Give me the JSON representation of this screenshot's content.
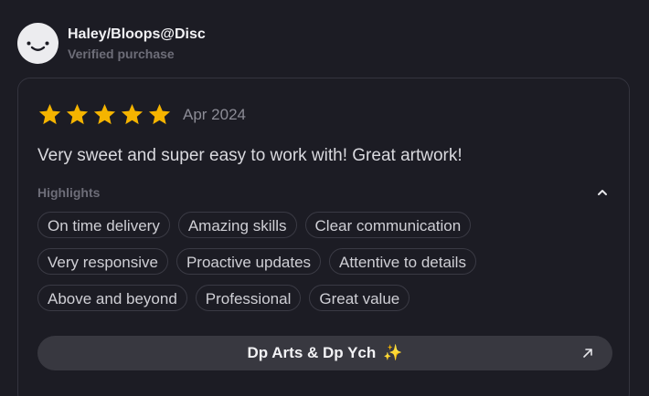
{
  "reviewer": {
    "name": "Haley/Bloops@Disc",
    "subtitle": "Verified purchase"
  },
  "review": {
    "rating": 5,
    "max_rating": 5,
    "date": "Apr 2024",
    "text": "Very sweet and super easy to work with! Great artwork!",
    "star_color": "#f5b400"
  },
  "highlights": {
    "label": "Highlights",
    "rows": [
      [
        "On time delivery",
        "Amazing skills",
        "Clear communication"
      ],
      [
        "Very responsive",
        "Proactive updates",
        "Attentive to details"
      ],
      [
        "Above and beyond",
        "Professional",
        "Great value"
      ]
    ]
  },
  "gig_button": {
    "label": "Dp Arts & Dp Ych",
    "emoji": "✨"
  },
  "icons": {
    "avatar": "smiley-face-icon",
    "collapse": "chevron-up-icon",
    "open": "arrow-up-right-icon"
  }
}
